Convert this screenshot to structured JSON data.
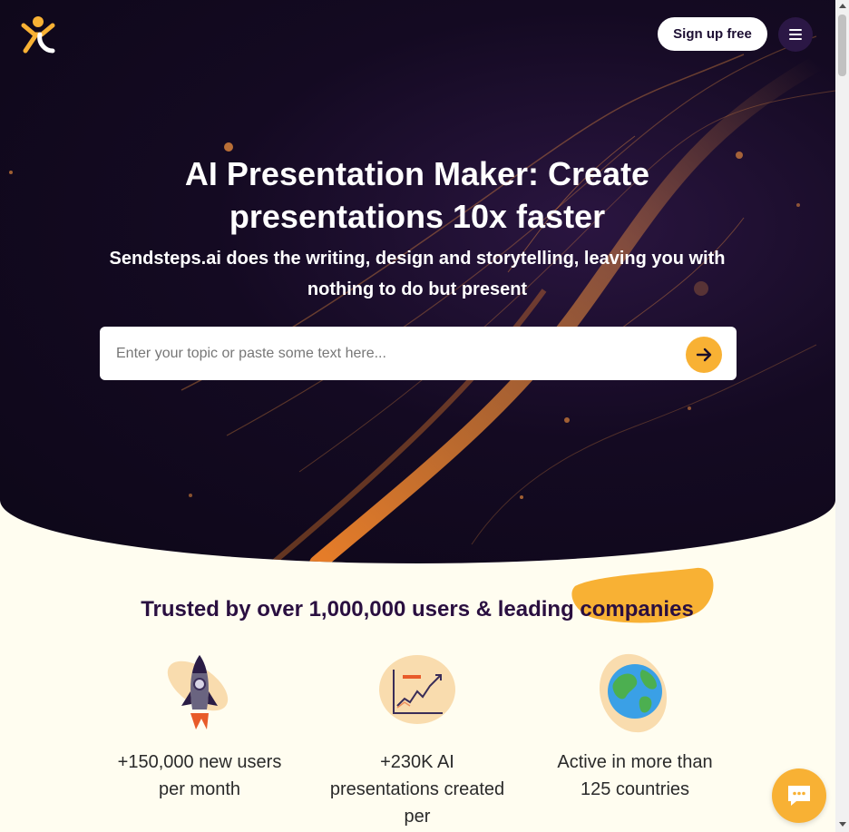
{
  "header": {
    "logo_icon": "sendsteps-logo-icon",
    "signup_label": "Sign up free",
    "menu_icon": "hamburger-icon"
  },
  "hero": {
    "title": "AI Presentation Maker: Create presentations 10x faster",
    "subtitle": "Sendsteps.ai does the writing, design and storytelling, leaving you with nothing to do but present",
    "search": {
      "placeholder": "Enter your topic or paste some text here...",
      "value": "",
      "submit_icon": "arrow-right-icon"
    }
  },
  "trusted": {
    "heading": "Trusted by over 1,000,000 users & leading companies",
    "stats": [
      {
        "icon": "rocket-icon",
        "caption": "+150,000 new users per month"
      },
      {
        "icon": "growth-chart-icon",
        "caption": "+230K AI presentations created per"
      },
      {
        "icon": "globe-icon",
        "caption": "Active in more than 125 countries"
      }
    ]
  },
  "chat": {
    "icon": "chat-bubble-icon"
  },
  "colors": {
    "hero_bg": "#140a22",
    "accent": "#f8b134",
    "heading": "#2a0f40",
    "page_bg": "#fffdf0"
  }
}
